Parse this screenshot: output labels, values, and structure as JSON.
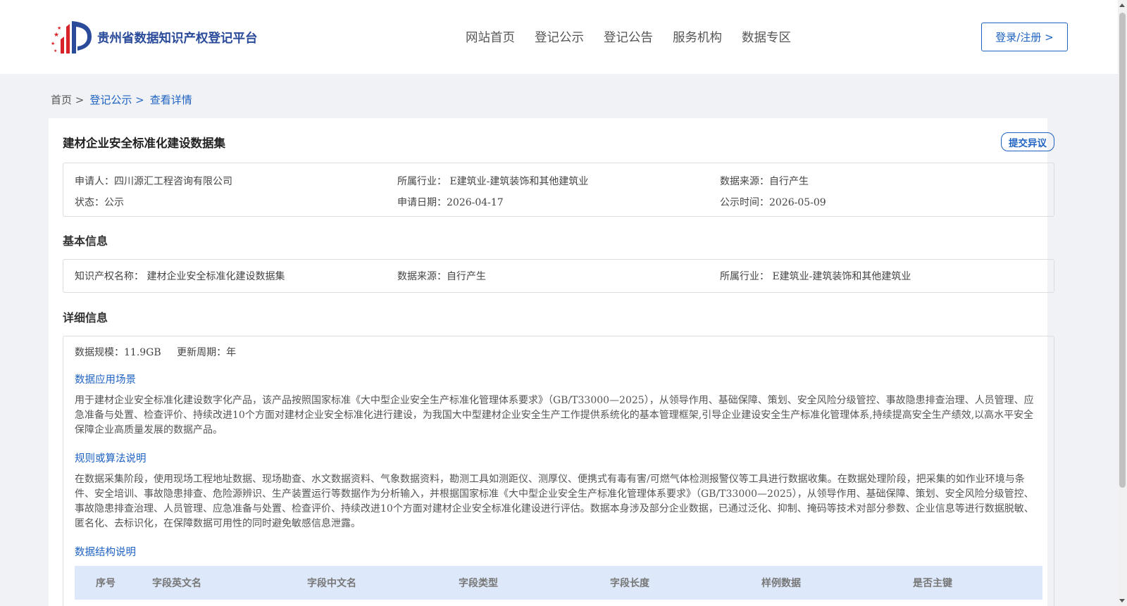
{
  "header": {
    "logo_text": "贵州省数据知识产权登记平台",
    "nav": [
      "网站首页",
      "登记公示",
      "登记公告",
      "服务机构",
      "数据专区"
    ],
    "login_label": "登录/注册 >"
  },
  "breadcrumb": {
    "home": "首页 >",
    "section": "登记公示 >",
    "current": "查看详情"
  },
  "detail": {
    "title": "建材企业安全标准化建设数据集",
    "objection_label": "提交异议",
    "summary": {
      "applicant": "申请人：四川源汇工程咨询有限公司",
      "industry": "所属行业： E建筑业-建筑装饰和其他建筑业",
      "source": "数据来源：自行产生",
      "status": "状态：公示",
      "apply_date": "申请日期：2026-04-17",
      "public_date": "公示时间：2026-05-09"
    },
    "basic": {
      "title": "基本信息",
      "name": "知识产权名称： 建材企业安全标准化建设数据集",
      "source": "数据来源：自行产生",
      "industry": "所属行业： E建筑业-建筑装饰和其他建筑业"
    },
    "info": {
      "title": "详细信息",
      "scale": "数据规模：11.9GB",
      "period": "更新周期：年",
      "scene_title": "数据应用场景",
      "scene_text": "用于建材企业安全标准化建设数字化产品，该产品按照国家标准《大中型企业安全生产标准化管理体系要求》（GB/T33000—2025），从领导作用、基础保障、策划、安全风险分级管控、事故隐患排查治理、人员管理、应急准备与处置、检查评价、持续改进10个方面对建材企业安全标准化进行建设，为我国大中型建材企业安全生产工作提供系统化的基本管理框架,引导企业建设安全生产标准化管理体系,持续提高安全生产绩效,以高水平安全保障企业高质量发展的数据产品。",
      "rule_title": "规则或算法说明",
      "rule_text": "在数据采集阶段，使用现场工程地址数据、现场勘查、水文数据资料、气象数据资料，勘测工具如测距仪、测厚仪、便携式有毒有害/可燃气体检测报警仪等工具进行数据收集。在数据处理阶段，把采集的如作业环境与条件、安全培训、事故隐患排查、危险源辨识、生产装置运行等数据作为分析输入，并根据国家标准《大中型企业安全生产标准化管理体系要求》（GB/T33000—2025），从领导作用、基础保障、策划、安全风险分级管控、事故隐患排查治理、人员管理、应急准备与处置、检查评价、持续改进10个方面对建材企业安全标准化建设进行评估。数据本身涉及部分企业数据，已通过泛化、抑制、掩码等技术对部分参数、企业信息等进行数据脱敏、匿名化、去标识化，在保障数据可用性的同时避免敏感信息泄露。",
      "struct_title": "数据结构说明",
      "table_headers": [
        "序号",
        "字段英文名",
        "字段中文名",
        "字段类型",
        "字段长度",
        "样例数据",
        "是否主键"
      ]
    }
  }
}
